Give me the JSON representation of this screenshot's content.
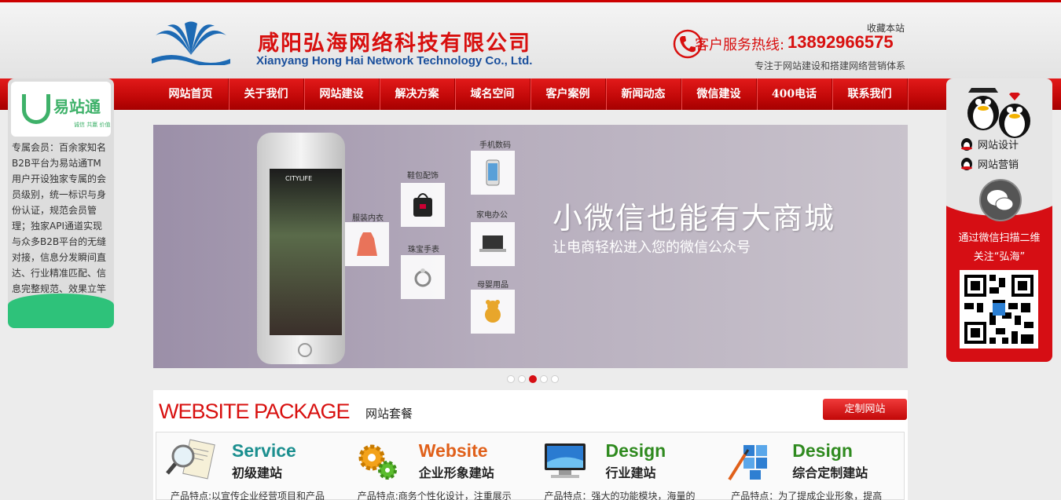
{
  "header": {
    "company_cn": "咸阳弘海网络科技有限公司",
    "company_en": "Xianyang Hong Hai Network Technology Co., Ltd.",
    "favorite": "收藏本站",
    "hotline_label": "客户服务热线:",
    "hotline_number": "13892966575",
    "tagline": "专注于网站建设和搭建网络营销体系",
    "icons": {
      "logo": "wave-logo-icon",
      "phone": "phone-icon"
    }
  },
  "nav": {
    "items": [
      "网站首页",
      "关于我们",
      "网站建设",
      "解决方案",
      "域名空间",
      "客户案例",
      "新闻动态",
      "微信建设",
      "400电话",
      "联系我们"
    ]
  },
  "left_float": {
    "brand": "易站通",
    "slogan": "诚信 共赢 价值",
    "text": "专属会员：百余家知名B2B平台为易站通TM用户开设独家专属的会员级别，统一标识与身份认证，规范会员管理；独家API通道实现与众多B2B平台的无缝对接，信息分发瞬间直达、行业精准匹配、信息完整规范、效果立竿见影；"
  },
  "right_float": {
    "qq_items": [
      "网站设计",
      "网站营销"
    ],
    "scan_line1": "通过微信扫描二维",
    "scan_line2": "关注“弘海”",
    "icons": {
      "qq": "qq-penguin-icon",
      "wechat": "wechat-icon",
      "qr": "qr-code"
    }
  },
  "banner": {
    "headline": "小微信也能有大商城",
    "subline": "让电商轻松进入您的微信公众号",
    "phone_app": "CITYLIFE",
    "tiles": [
      "手机数码",
      "鞋包配饰",
      "服装内衣",
      "家电办公",
      "珠宝手表",
      "母婴用品"
    ],
    "slide_count": 5,
    "active_slide": 3
  },
  "package": {
    "title": "WEBSITE PACKAGE",
    "subtitle": "网站套餐",
    "custom_button": "定制网站",
    "items": [
      {
        "en": "Service",
        "cn": "初级建站",
        "desc": "产品特点:以宣传企业经营项目和产品",
        "color": "#1b8f8f",
        "icon": "magnifier-doc-icon"
      },
      {
        "en": "Website",
        "cn": "企业形象建站",
        "desc": "产品特点:商务个性化设计，注重展示",
        "color": "#e0601a",
        "icon": "gears-icon"
      },
      {
        "en": "Design",
        "cn": "行业建站",
        "desc": "产品特点：强大的功能模块，海量的",
        "color": "#2f8a1f",
        "icon": "monitor-icon"
      },
      {
        "en": "Design",
        "cn": "综合定制建站",
        "desc": "产品特点：为了提成企业形象，提高",
        "color": "#2f8a1f",
        "icon": "blocks-icon"
      }
    ]
  }
}
